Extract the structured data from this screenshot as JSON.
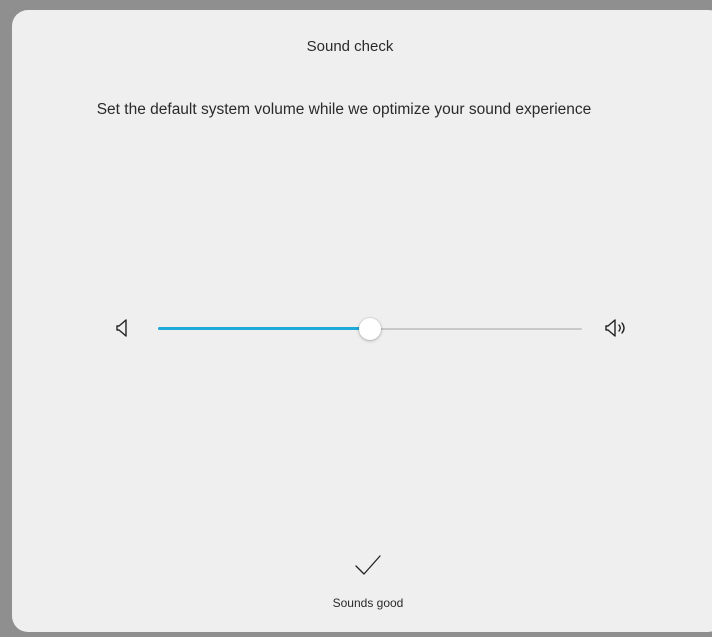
{
  "dialog": {
    "title": "Sound check",
    "subtitle": "Set the default system volume while we optimize your sound experience"
  },
  "volume": {
    "level_fraction": 0.5,
    "accent_color": "#1fa9d9",
    "track_color": "#c9c9c9",
    "min_icon": "speaker-low-icon",
    "max_icon": "speaker-high-icon"
  },
  "confirm": {
    "icon": "checkmark-icon",
    "label": "Sounds good"
  }
}
